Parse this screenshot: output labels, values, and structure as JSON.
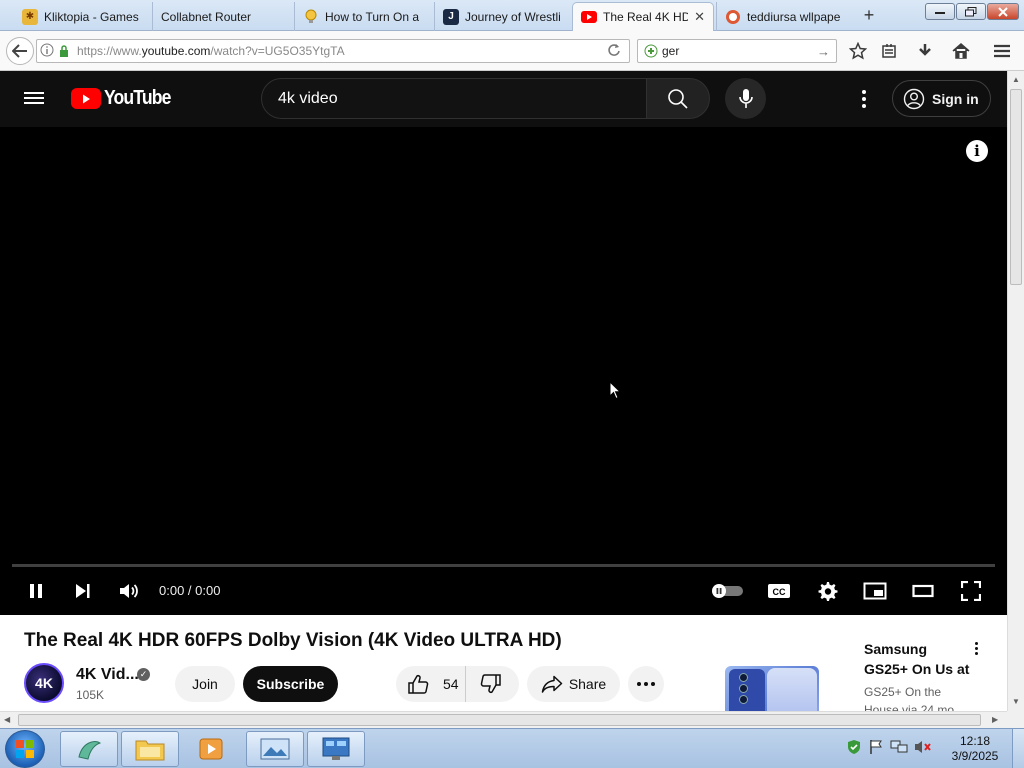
{
  "browser": {
    "tabs": [
      {
        "title": "Kliktopia - Games",
        "favicon": "puzzle-favicon",
        "active": false
      },
      {
        "title": "Collabnet Router",
        "favicon": "",
        "active": false
      },
      {
        "title": "How to Turn On a",
        "favicon": "lightbulb-favicon",
        "active": false
      },
      {
        "title": "Journey of Wrestli",
        "favicon": "j-favicon",
        "active": false
      },
      {
        "title": "The Real 4K HD",
        "favicon": "youtube-favicon",
        "active": true
      },
      {
        "title": "teddiursa wllpape",
        "favicon": "duckduckgo-favicon",
        "active": false
      }
    ],
    "tab_close": "✕",
    "new_tab": "+",
    "url_prefix": "https://www.",
    "url_domain": "youtube.com",
    "url_path": "/watch?v=UG5O35YtgTA",
    "search_value": "ger"
  },
  "youtube": {
    "logo_text": "YouTube",
    "search_value": "4k video",
    "signin_label": "Sign in",
    "accent_color": "#ff0000"
  },
  "player": {
    "time": "0:00 / 0:00",
    "progress": 0,
    "autoplay_on": false
  },
  "video": {
    "title": "The Real 4K HDR 60FPS Dolby Vision (4K Video ULTRA HD)",
    "channel_avatar_text": "4K",
    "channel_name": "4K Vid...",
    "subscribers": "105K",
    "join_label": "Join",
    "subscribe_label": "Subscribe",
    "likes": "54",
    "share_label": "Share"
  },
  "ad": {
    "title": "Samsung GS25+ On Us at",
    "description": "GS25+ On the House via 24 mo"
  },
  "taskbar": {
    "time": "12:18",
    "date": "3/9/2025"
  }
}
